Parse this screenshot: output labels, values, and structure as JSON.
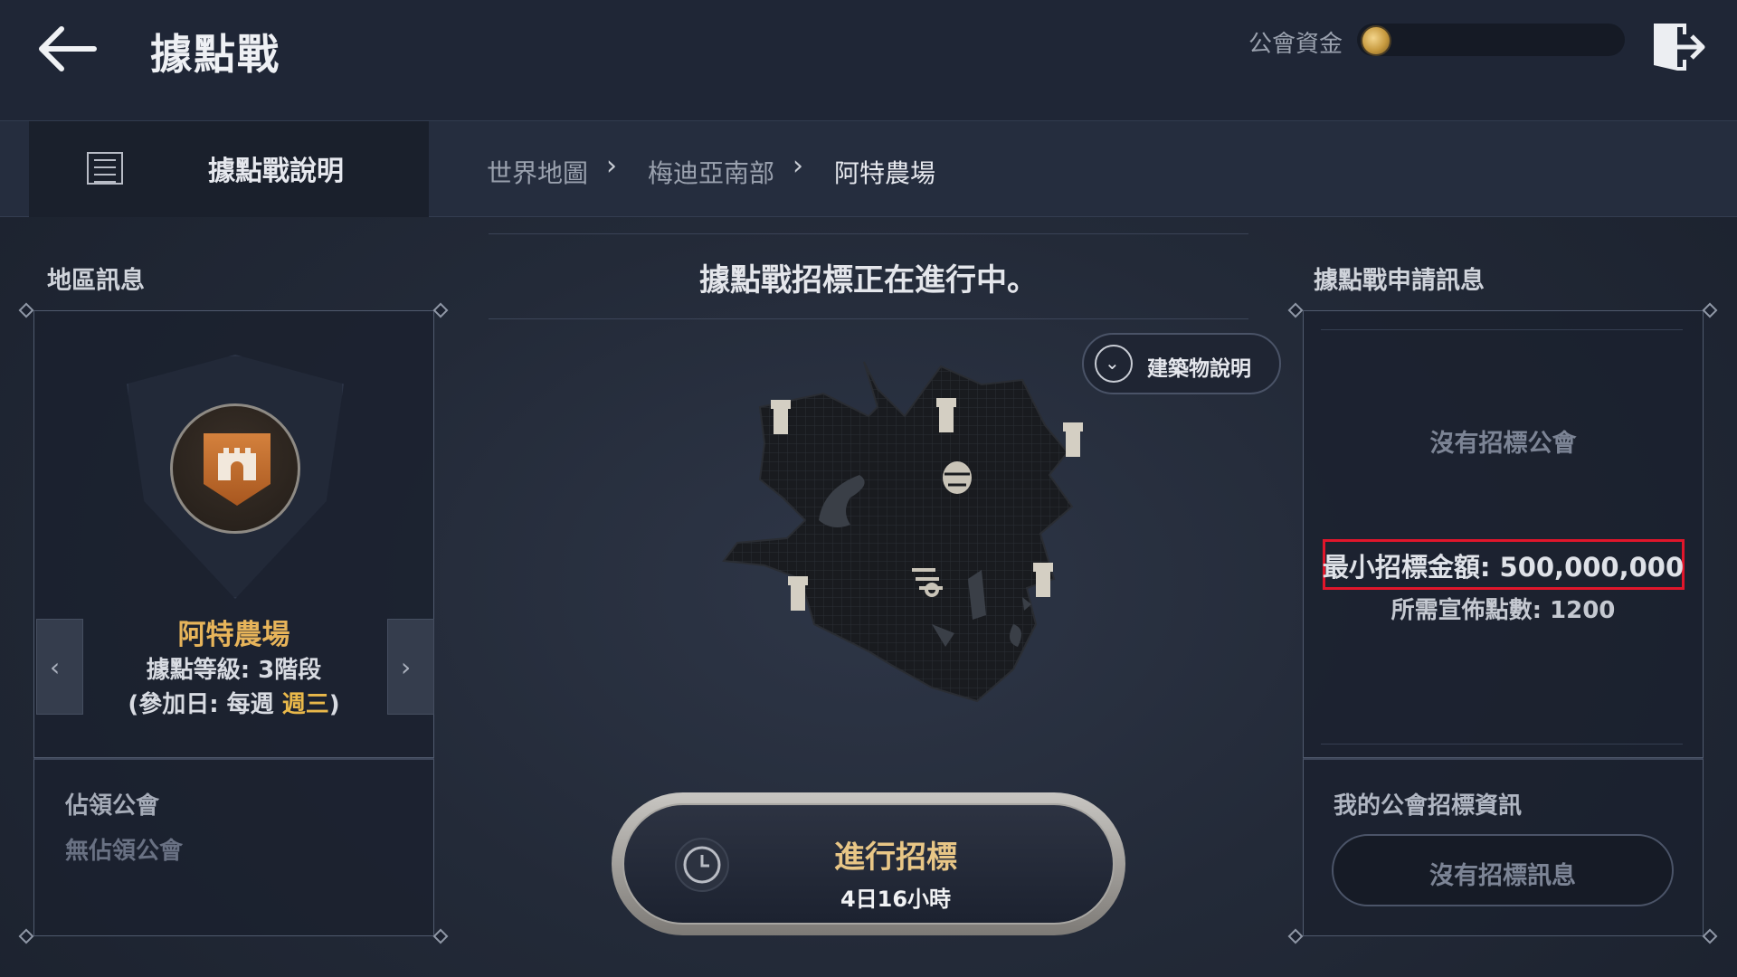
{
  "header": {
    "title": "據點戰",
    "funds_label": "公會資金",
    "icons": {
      "back": "arrow-left-icon",
      "exit": "exit-door-icon",
      "coin": "coin-icon"
    }
  },
  "subnav": {
    "guide_label": "據點戰說明",
    "breadcrumb": [
      "世界地圖",
      "梅迪亞南部",
      "阿特農場"
    ]
  },
  "left_panel": {
    "title": "地區訊息",
    "region_name": "阿特農場",
    "level_text": "據點等級: 3階段",
    "day_prefix": "(參加日: 每週 ",
    "day_highlight": "週三",
    "day_suffix": ")",
    "occupied_title": "佔領公會",
    "occupied_value": "無佔領公會"
  },
  "center": {
    "status_title": "據點戰招標正在進行中。",
    "building_info_label": "建築物說明",
    "bid_button_label": "進行招標",
    "bid_time_remaining": "4日16小時"
  },
  "right_panel": {
    "title": "據點戰申請訊息",
    "no_bidding_guild": "沒有招標公會",
    "min_bid": "最小招標金額: 500,000,000",
    "required_points": "所需宣佈點數: 1200",
    "my_bid_title": "我的公會招標資訊",
    "my_bid_value": "沒有招標訊息"
  },
  "colors": {
    "accent_gold": "#e7b45a",
    "highlight_day": "#e9b84a",
    "highlight_box": "#e0162b",
    "background": "#232a38"
  }
}
